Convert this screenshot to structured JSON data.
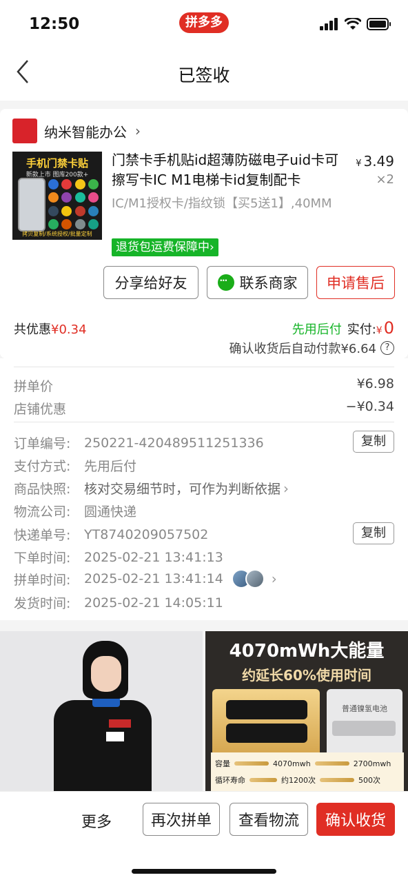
{
  "status_bar": {
    "time": "12:50",
    "app_badge": "拼多多"
  },
  "nav": {
    "title": "已签收"
  },
  "shop": {
    "name": "纳米智能办公",
    "arrow": "›"
  },
  "product": {
    "image_title": "手机门禁卡贴",
    "image_sub": "新款上市 图库200款+",
    "image_foot": "拷贝复制/系统授权/批量定制",
    "title": "门禁卡手机贴id超薄防磁电子uid卡可擦写卡IC M1电梯卡id复制配卡",
    "price_currency": "¥",
    "price": "3.49",
    "quantity": "×2",
    "spec": "IC/M1授权卡/指纹锁【买5送1】,40MM",
    "return_badge": "退货包运费保障中›"
  },
  "actions": {
    "share": "分享给好友",
    "contact": "联系商家",
    "after_sale": "申请售后"
  },
  "summary": {
    "discount_label": "共优惠",
    "discount_value": "¥0.34",
    "pay_later": "先用后付",
    "paid_label": "实付:",
    "paid_currency": "¥",
    "paid_value": "0",
    "auto_pay": "确认收货后自动付款¥6.64",
    "help": "?"
  },
  "prices": {
    "group_price_label": "拼单价",
    "group_price_value": "¥6.98",
    "shop_discount_label": "店铺优惠",
    "shop_discount_value": "−¥0.34"
  },
  "order_info": {
    "order_no_label": "订单编号:",
    "order_no": "250221-420489511251336",
    "copy": "复制",
    "payment_label": "支付方式:",
    "payment": "先用后付",
    "snapshot_label": "商品快照:",
    "snapshot": "核对交易细节时，可作为判断依据",
    "snapshot_arrow": "›",
    "logistics_label": "物流公司:",
    "logistics": "圆通快递",
    "tracking_label": "快递单号:",
    "tracking": "YT8740209057502",
    "order_time_label": "下单时间:",
    "order_time": "2025-02-21 13:41:13",
    "group_time_label": "拼单时间:",
    "group_time": "2025-02-21 13:41:14",
    "group_arrow": "›",
    "ship_time_label": "发货时间:",
    "ship_time": "2025-02-21 14:05:11"
  },
  "recommend": {
    "right_title": "4070mWh大能量",
    "right_sub": "约延长60%使用时间",
    "normal_label": "普通镍氢电池",
    "row1_label": "容量",
    "row1_a": "4070mwh",
    "row1_b": "2700mwh",
    "row2_label": "循环寿命",
    "row2_a": "约1200次",
    "row2_b": "500次"
  },
  "bottom": {
    "more": "更多",
    "again": "再次拼单",
    "logistics": "查看物流",
    "confirm": "确认收货"
  },
  "colors": {
    "accent": "#e02e24",
    "green": "#16b428"
  }
}
